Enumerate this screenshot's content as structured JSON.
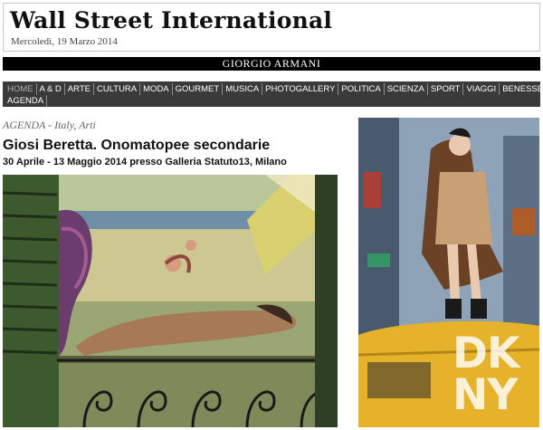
{
  "site": {
    "logo": "Wall Street International",
    "date": "Mercoledì, 19 Marzo 2014"
  },
  "ad_banner": {
    "text": "GIORGIO ARMANI"
  },
  "nav": {
    "row1": [
      "HOME",
      "A & D",
      "ARTE",
      "CULTURA",
      "MODA",
      "GOURMET",
      "MUSICA",
      "PHOTOGALLERY",
      "POLITICA",
      "SCIENZA",
      "SPORT",
      "VIAGGI",
      "BENESSERE"
    ],
    "row2": [
      "AGENDA"
    ],
    "active": "HOME"
  },
  "article": {
    "section": "AGENDA - Italy, Arti",
    "title": "Giosi Beretta. Onomatopee secondarie",
    "subtitle": "30 Aprile - 13 Maggio 2014 presso Galleria Statuto13, Milano"
  },
  "side_ad": {
    "brand_line1": "DK",
    "brand_line2": "NY"
  },
  "colors": {
    "nav_bg": "#3a3a3a",
    "banner_bg": "#000000",
    "painting_green": "#8f9d6b",
    "taxi_yellow": "#e6b22a"
  }
}
